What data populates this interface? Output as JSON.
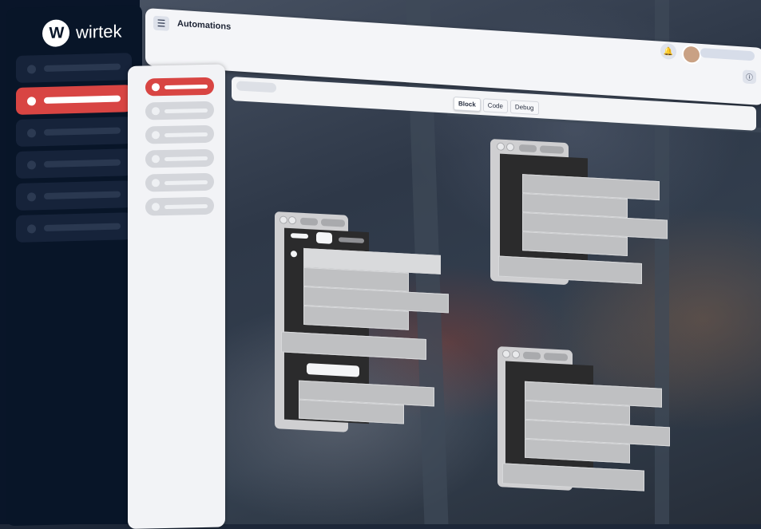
{
  "brand": {
    "name": "wirtek",
    "mark": "W",
    "accent": "#d84543",
    "sidebar_bg": "#081528"
  },
  "header": {
    "title": "Automations",
    "menu_icon": "☰",
    "bell_icon": "🔔",
    "info_icon": "ⓘ"
  },
  "editor": {
    "modes": [
      "Block",
      "Code",
      "Debug"
    ],
    "active_mode": "Block"
  },
  "sidebar": {
    "items": [
      {
        "active": false
      },
      {
        "active": true
      },
      {
        "active": false
      },
      {
        "active": false
      },
      {
        "active": false
      },
      {
        "active": false
      }
    ]
  },
  "panel": {
    "items": [
      {
        "active": true
      },
      {
        "active": false
      },
      {
        "active": false
      },
      {
        "active": false
      },
      {
        "active": false
      },
      {
        "active": false
      }
    ]
  }
}
